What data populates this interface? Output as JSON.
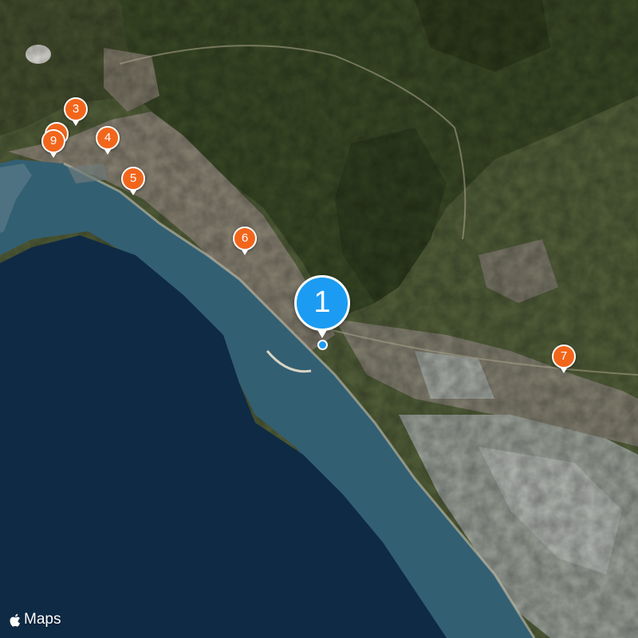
{
  "map": {
    "type": "satellite",
    "attribution": "Maps",
    "colors": {
      "sea_deep": "#0f2a45",
      "sea_shallow": "#2f5a6f",
      "land": "#4e5c33",
      "hills": "#3a4a26",
      "urban": "#8c8675",
      "greenhouse": "#a9aea8",
      "pin_orange": "#f2661c",
      "pin_blue": "#1b9cf2"
    }
  },
  "markers": [
    {
      "label": "1",
      "style": "primary"
    },
    {
      "label": "3",
      "style": "secondary"
    },
    {
      "label": "4",
      "style": "secondary"
    },
    {
      "label": "5",
      "style": "secondary"
    },
    {
      "label": "6",
      "style": "secondary"
    },
    {
      "label": "7",
      "style": "secondary"
    },
    {
      "label": "9",
      "style": "secondary"
    }
  ]
}
